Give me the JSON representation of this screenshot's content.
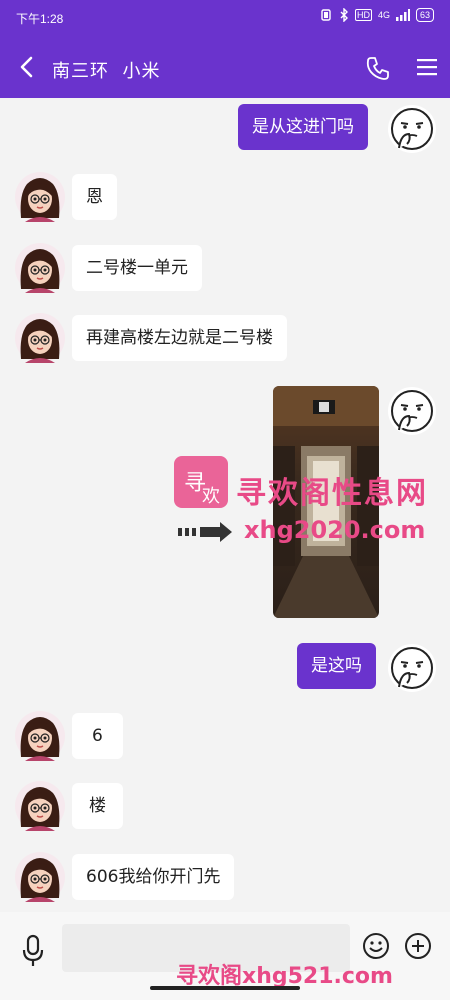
{
  "status": {
    "time": "下午1:28",
    "net": "4G",
    "hd": "HD",
    "battery": "63"
  },
  "header": {
    "title": "南三环  小米"
  },
  "messages": [
    {
      "side": "right",
      "text": "是从这进门吗"
    },
    {
      "side": "left",
      "text": "恩"
    },
    {
      "side": "left",
      "text": "二号楼一单元"
    },
    {
      "side": "left",
      "text": "再建高楼左边就是二号楼"
    },
    {
      "side": "right",
      "type": "image"
    },
    {
      "side": "right",
      "text": "是这吗"
    },
    {
      "side": "left",
      "text": "6"
    },
    {
      "side": "left",
      "text": "楼"
    },
    {
      "side": "left",
      "text": "606我给你开门先"
    }
  ],
  "watermark": {
    "line1": "寻欢阁性息网",
    "line2": "xhg2020.com",
    "bottom": "寻欢阁xhg521.com"
  },
  "colors": {
    "accent": "#6a33cd",
    "watermark": "#e84a87"
  }
}
